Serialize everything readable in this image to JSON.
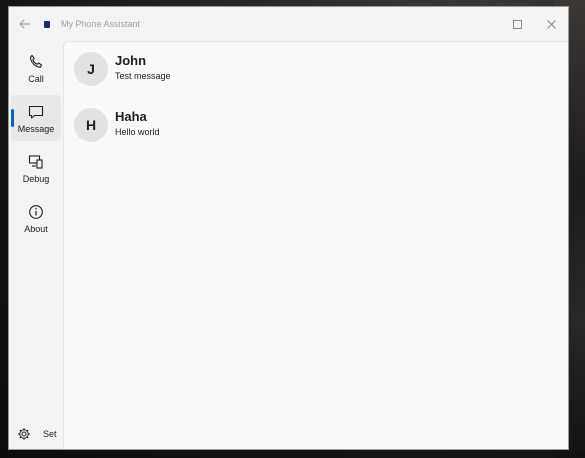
{
  "window": {
    "title": "My Phone Assistant",
    "back_icon": "back-arrow-icon",
    "app_icon": "app-icon",
    "maximize_icon": "maximize-icon",
    "close_icon": "close-icon"
  },
  "nav": {
    "items": [
      {
        "label": "Call",
        "icon": "phone-icon"
      },
      {
        "label": "Message",
        "icon": "chat-icon",
        "selected": true
      },
      {
        "label": "Debug",
        "icon": "devices-icon"
      },
      {
        "label": "About",
        "icon": "info-icon"
      }
    ],
    "settings": {
      "label": "Set",
      "icon": "gear-icon"
    }
  },
  "messages": [
    {
      "initial": "J",
      "name": "John",
      "text": "Test message"
    },
    {
      "initial": "H",
      "name": "Haha",
      "text": "Hello world"
    }
  ],
  "colors": {
    "accent": "#0067c0",
    "avatar_bg": "#e2e2e2",
    "content_bg": "#f9f9f9",
    "nav_bg": "#f3f3f3"
  }
}
